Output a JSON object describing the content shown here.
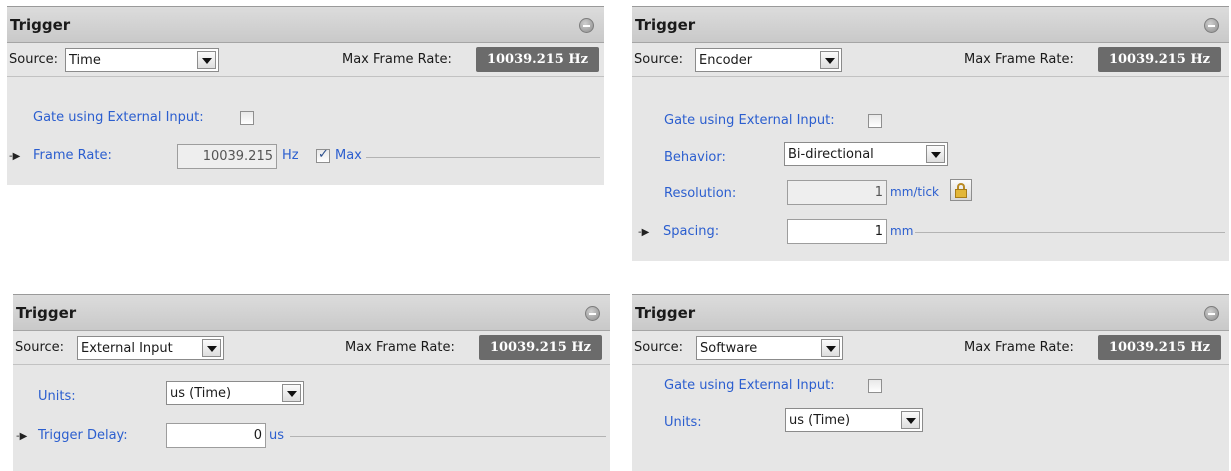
{
  "panels": [
    {
      "title": "Trigger",
      "source_label": "Source:",
      "source_value": "Time",
      "max_frame_rate_label": "Max Frame Rate:",
      "max_frame_rate_value": "10039.215 Hz",
      "gate_label": "Gate using External Input:",
      "gate_checked": false,
      "frame_rate_label": "Frame Rate:",
      "frame_rate_value": "10039.215",
      "frame_rate_unit": "Hz",
      "max_label": "Max",
      "max_checked": true
    },
    {
      "title": "Trigger",
      "source_label": "Source:",
      "source_value": "Encoder",
      "max_frame_rate_label": "Max Frame Rate:",
      "max_frame_rate_value": "10039.215 Hz",
      "gate_label": "Gate using External Input:",
      "gate_checked": false,
      "behavior_label": "Behavior:",
      "behavior_value": "Bi-directional",
      "resolution_label": "Resolution:",
      "resolution_value": "1",
      "resolution_unit": "mm/tick",
      "spacing_label": "Spacing:",
      "spacing_value": "1",
      "spacing_unit": "mm"
    },
    {
      "title": "Trigger",
      "source_label": "Source:",
      "source_value": "External Input",
      "max_frame_rate_label": "Max Frame Rate:",
      "max_frame_rate_value": "10039.215 Hz",
      "units_label": "Units:",
      "units_value": "us (Time)",
      "trigger_delay_label": "Trigger Delay:",
      "trigger_delay_value": "0",
      "trigger_delay_unit": "us"
    },
    {
      "title": "Trigger",
      "source_label": "Source:",
      "source_value": "Software",
      "max_frame_rate_label": "Max Frame Rate:",
      "max_frame_rate_value": "10039.215 Hz",
      "gate_label": "Gate using External Input:",
      "gate_checked": false,
      "units_label": "Units:",
      "units_value": "us (Time)"
    }
  ]
}
